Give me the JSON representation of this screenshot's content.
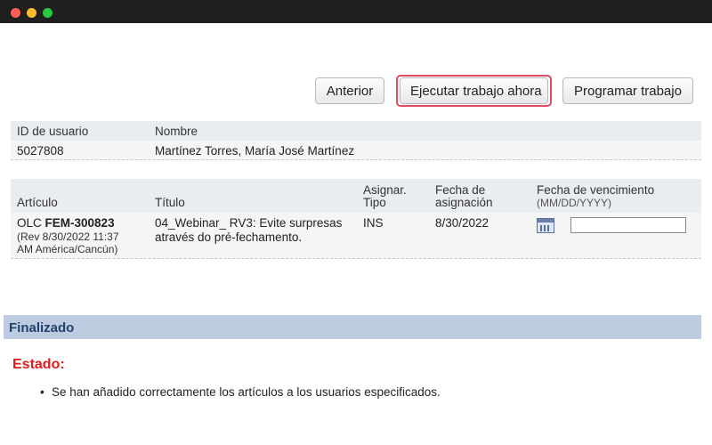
{
  "window": {
    "controls": [
      "close",
      "minimize",
      "maximize"
    ]
  },
  "toolbar": {
    "prev_label": "Anterior",
    "run_label": "Ejecutar trabajo ahora",
    "schedule_label": "Programar trabajo"
  },
  "user_table": {
    "headers": {
      "user_id": "ID de usuario",
      "name": "Nombre"
    },
    "row": {
      "user_id": "5027808",
      "name": "Martínez Torres, María José Martínez"
    }
  },
  "item_table": {
    "headers": {
      "article": "Artículo",
      "title": "Título",
      "assign_type_1": "Asignar.",
      "assign_type_2": "Tipo",
      "assign_date_1": "Fecha de",
      "assign_date_2": "asignación",
      "due_date": "Fecha de vencimiento",
      "due_date_format": "(MM/DD/YYYY)"
    },
    "row": {
      "article_prefix": "OLC",
      "article_code": "FEM-300823",
      "article_rev_1": "(Rev 8/30/2022 11:37",
      "article_rev_2": "AM América/Cancún)",
      "title_1": "04_Webinar_ RV3: Evite surpresas",
      "title_2": "através do pré-fechamento.",
      "assign_type": "INS",
      "assign_date": "8/30/2022",
      "due_date_value": ""
    }
  },
  "section": {
    "title": "Finalizado"
  },
  "status": {
    "label": "Estado:",
    "bullet": "•",
    "message": "Se han añadido correctamente los artículos a los usuarios especificados."
  }
}
